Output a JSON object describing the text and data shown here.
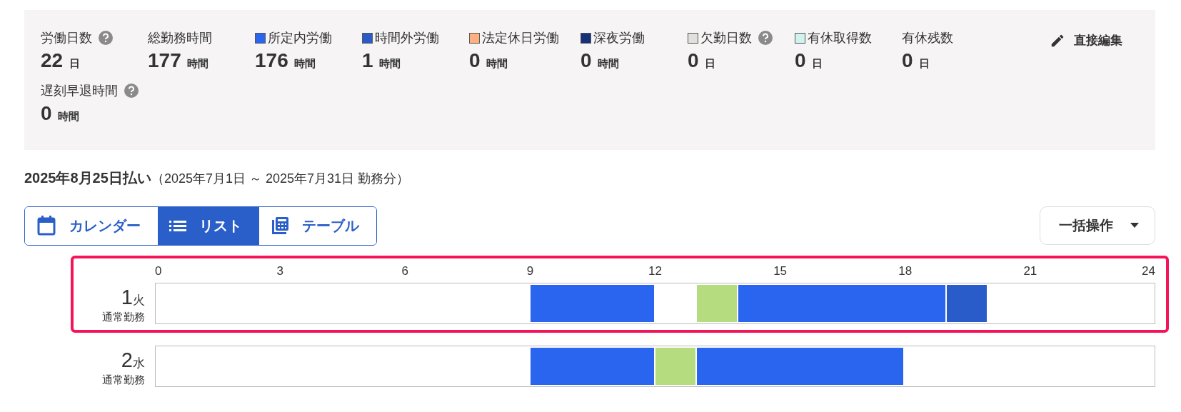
{
  "summary": {
    "items": [
      {
        "label": "労働日数",
        "help": true,
        "value": "22",
        "unit": "日"
      },
      {
        "label": "総勤務時間",
        "help": false,
        "value": "177",
        "unit": "時間"
      },
      {
        "label": "所定内労働",
        "color": "#2965ee",
        "help": false,
        "value": "176",
        "unit": "時間"
      },
      {
        "label": "時間外労働",
        "color": "#295cc8",
        "help": false,
        "value": "1",
        "unit": "時間"
      },
      {
        "label": "法定休日労働",
        "color": "#ffb07e",
        "help": false,
        "value": "0",
        "unit": "時間"
      },
      {
        "label": "深夜労働",
        "color": "#17307a",
        "help": false,
        "value": "0",
        "unit": "時間"
      },
      {
        "label": "欠勤日数",
        "color": "#e2dfdf",
        "help": true,
        "value": "0",
        "unit": "日"
      },
      {
        "label": "有休取得数",
        "color": "#d2f2ef",
        "help": false,
        "value": "0",
        "unit": "日"
      },
      {
        "label": "有休残数",
        "help": false,
        "value": "0",
        "unit": "日"
      },
      {
        "label": "遅刻早退時間",
        "help": true,
        "value": "0",
        "unit": "時間"
      }
    ],
    "edit_button": "直接編集"
  },
  "period": {
    "title": "2025年8月25日払い",
    "range": "（2025年7月1日 ～ 2025年7月31日 勤務分）"
  },
  "view_tabs": [
    {
      "label": "カレンダー",
      "kind": "calendar",
      "selected": false
    },
    {
      "label": "リスト",
      "kind": "list",
      "selected": true
    },
    {
      "label": "テーブル",
      "kind": "table",
      "selected": false
    }
  ],
  "bulk_button": "一括操作",
  "rows": [
    {
      "day": "1",
      "weekday": "火",
      "type": "通常勤務",
      "selected": true,
      "ticks": [
        "0",
        "3",
        "6",
        "9",
        "12",
        "15",
        "18",
        "21",
        "24"
      ],
      "hours": [
        {
          "kind": "empty"
        },
        {
          "kind": "empty"
        },
        {
          "kind": "empty"
        },
        {
          "kind": "empty"
        },
        {
          "kind": "empty"
        },
        {
          "kind": "empty"
        },
        {
          "kind": "empty"
        },
        {
          "kind": "empty"
        },
        {
          "kind": "empty"
        },
        {
          "kind": "filled",
          "color": "#2965ee"
        },
        {
          "kind": "filled",
          "color": "#2965ee"
        },
        {
          "kind": "filled",
          "color": "#2965ee"
        },
        {
          "kind": "empty"
        },
        {
          "kind": "filled",
          "color": "#b5dc7e"
        },
        {
          "kind": "filled",
          "color": "#2965ee"
        },
        {
          "kind": "filled",
          "color": "#2965ee"
        },
        {
          "kind": "filled",
          "color": "#2965ee"
        },
        {
          "kind": "filled",
          "color": "#2965ee"
        },
        {
          "kind": "filled",
          "color": "#2965ee"
        },
        {
          "kind": "filled",
          "color": "#295cc8"
        },
        {
          "kind": "empty"
        },
        {
          "kind": "empty"
        },
        {
          "kind": "empty"
        },
        {
          "kind": "empty"
        }
      ]
    },
    {
      "day": "2",
      "weekday": "水",
      "type": "通常勤務",
      "selected": false,
      "hours": [
        {
          "kind": "empty"
        },
        {
          "kind": "empty"
        },
        {
          "kind": "empty"
        },
        {
          "kind": "empty"
        },
        {
          "kind": "empty"
        },
        {
          "kind": "empty"
        },
        {
          "kind": "empty"
        },
        {
          "kind": "empty"
        },
        {
          "kind": "empty"
        },
        {
          "kind": "filled",
          "color": "#2965ee"
        },
        {
          "kind": "filled",
          "color": "#2965ee"
        },
        {
          "kind": "filled",
          "color": "#2965ee"
        },
        {
          "kind": "filled",
          "color": "#b5dc7e"
        },
        {
          "kind": "filled",
          "color": "#2965ee"
        },
        {
          "kind": "filled",
          "color": "#2965ee"
        },
        {
          "kind": "filled",
          "color": "#2965ee"
        },
        {
          "kind": "filled",
          "color": "#2965ee"
        },
        {
          "kind": "filled",
          "color": "#2965ee"
        },
        {
          "kind": "empty"
        },
        {
          "kind": "empty"
        },
        {
          "kind": "empty"
        },
        {
          "kind": "empty"
        },
        {
          "kind": "empty"
        },
        {
          "kind": "empty"
        }
      ]
    }
  ]
}
